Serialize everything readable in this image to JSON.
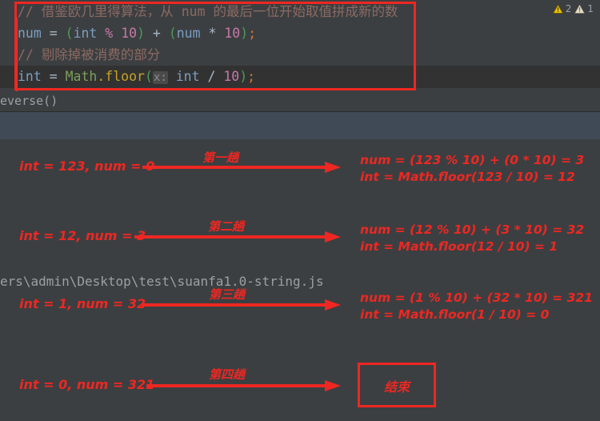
{
  "editor": {
    "lines": [
      {
        "id": "code-line-1",
        "tokens": [
          {
            "text": "// 借鉴欧几里得算法，从 num 的最后一位开始取值拼成新的数",
            "cls": "tok-comment"
          }
        ]
      },
      {
        "id": "code-line-2",
        "tokens": [
          {
            "text": "num",
            "cls": "tok-ident"
          },
          {
            "text": " = ",
            "cls": "tok-op"
          },
          {
            "text": "(",
            "cls": "tok-paren"
          },
          {
            "text": "int",
            "cls": "tok-ident"
          },
          {
            "text": " % ",
            "cls": "tok-num"
          },
          {
            "text": "10",
            "cls": "tok-num"
          },
          {
            "text": ")",
            "cls": "tok-paren"
          },
          {
            "text": " + ",
            "cls": "tok-op"
          },
          {
            "text": "(",
            "cls": "tok-paren"
          },
          {
            "text": "num",
            "cls": "tok-ident"
          },
          {
            "text": " * ",
            "cls": "tok-op"
          },
          {
            "text": "10",
            "cls": "tok-num"
          },
          {
            "text": ")",
            "cls": "tok-paren"
          },
          {
            "text": ";",
            "cls": "tok-semi"
          }
        ]
      },
      {
        "id": "code-line-3",
        "tokens": [
          {
            "text": "// 剔除掉被消费的部分",
            "cls": "tok-comment"
          }
        ]
      },
      {
        "id": "code-line-4",
        "tokens": [
          {
            "text": "int",
            "cls": "tok-ident"
          },
          {
            "text": " = ",
            "cls": "tok-op"
          },
          {
            "text": "Math",
            "cls": "tok-class"
          },
          {
            "text": ".floor",
            "cls": "tok-fn"
          },
          {
            "text": "(",
            "cls": "tok-paren"
          },
          {
            "text": "x:",
            "cls": "param-hint"
          },
          {
            "text": " int",
            "cls": "tok-ident"
          },
          {
            "text": " / ",
            "cls": "tok-op"
          },
          {
            "text": "10",
            "cls": "tok-num"
          },
          {
            "text": ")",
            "cls": "tok-paren"
          },
          {
            "text": ";",
            "cls": "tok-semi"
          }
        ]
      }
    ],
    "highlight_box_color": "#ee2722"
  },
  "inspections": {
    "warning_count": "2",
    "weak_warning_count": "1",
    "warning_color": "#f2c200",
    "weak_warning_color": "#e8e0cc"
  },
  "breadcrumb": {
    "text": "everse()"
  },
  "output": {
    "path": "ers\\admin\\Desktop\\test\\suanfa1.0-string.js"
  },
  "annotations": {
    "accent_color": "#ee2722",
    "rows": [
      {
        "state": "int = 123, num = 0",
        "pass": "第一趟",
        "results": [
          "num = (123 % 10) + (0 * 10) = 3",
          "int = Math.floor(123 / 10) = 12"
        ]
      },
      {
        "state": "int = 12, num = 3",
        "pass": "第二趟",
        "results": [
          "num = (12 % 10) + (3 * 10) = 32",
          "int = Math.floor(12 / 10) = 1"
        ]
      },
      {
        "state": "int = 1, num = 32",
        "pass": "第三趟",
        "results": [
          "num = (1 % 10) + (32 * 10) = 321",
          "int = Math.floor(1 / 10) = 0"
        ]
      },
      {
        "state": "int = 0, num = 321",
        "pass": "第四趟",
        "results": []
      }
    ],
    "end_box_label": "结束"
  }
}
